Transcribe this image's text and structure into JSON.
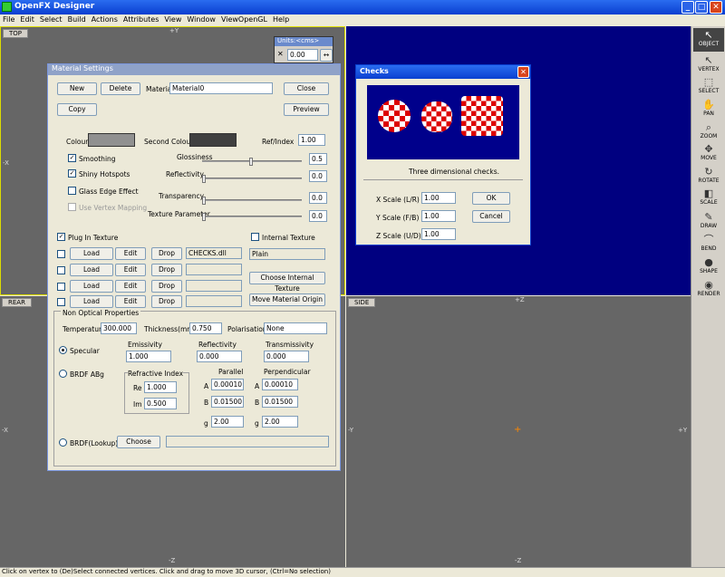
{
  "app": {
    "title": "OpenFX Designer",
    "min": "_",
    "max": "□",
    "close": "✕"
  },
  "menu": [
    "File",
    "Edit",
    "Select",
    "Build",
    "Actions",
    "Attributes",
    "View",
    "Window",
    "ViewOpenGL",
    "Help"
  ],
  "viewports": {
    "top": {
      "label": "TOP",
      "plus": "+Y",
      "minus": "-Y",
      "left": "-X",
      "right": "+X"
    },
    "rear": {
      "label": "REAR",
      "plus": "+Z",
      "minus": "-Z",
      "left": "-X",
      "right": "+X"
    },
    "side": {
      "label": "SIDE",
      "plus": "+Z",
      "minus": "-Z",
      "left": "-Y",
      "right": "+Y"
    }
  },
  "units": {
    "title": "Units:<cms>",
    "value": "0.00",
    "x": "✕",
    "icon": "↔"
  },
  "toolbar": [
    "OBJECT",
    "VERTEX",
    "SELECT",
    "PAN",
    "ZOOM",
    "MOVE",
    "ROTATE",
    "SCALE",
    "DRAW",
    "BEND",
    "SHAPE",
    "RENDER"
  ],
  "material": {
    "title": "Material Settings",
    "new": "New",
    "delete": "Delete",
    "material_label": "Material",
    "material_value": "Material0",
    "close": "Close",
    "copy": "Copy",
    "preview": "Preview",
    "colour": "Colour",
    "second_colour": "Second Colour",
    "refindex_label": "Ref/Index",
    "refindex": "1.00",
    "smoothing": "Smoothing",
    "shiny": "Shiny Hotspots",
    "glass": "Glass Edge Effect",
    "vertex_mapping": "Use Vertex Mapping",
    "glossiness": "Glossiness",
    "glossiness_val": "0.5",
    "reflectivity": "Reflectivity",
    "reflectivity_val": "0.0",
    "transparency": "Transparency",
    "transparency_val": "0.0",
    "texture_param": "Texture Parameter",
    "texture_param_val": "0.0",
    "plugin_texture": "Plug In Texture",
    "internal_texture": "Internal Texture",
    "internal_value": "Plain",
    "load": "Load",
    "edit": "Edit",
    "drop": "Drop",
    "dll": "CHECKS.dll",
    "choose_internal": "Choose Internal Texture",
    "move_origin": "Move Material Origin",
    "non_optical": "Non Optical Properties",
    "temperature": "Temperature",
    "temperature_val": "300.000",
    "thickness": "Thickness(mm)",
    "thickness_val": "0.750",
    "polarisation": "Polarisation",
    "polarisation_val": "None",
    "specular": "Specular",
    "emissivity": "Emissivity",
    "emissivity_val": "1.000",
    "reflectivity2": "Reflectivity",
    "reflectivity2_val": "0.000",
    "transmissivity": "Transmissivity",
    "transmissivity_val": "0.000",
    "brdf": "BRDF ABg",
    "refractive": "Refractive Index",
    "re": "Re",
    "re_val": "1.000",
    "im": "Im",
    "im_val": "0.500",
    "parallel": "Parallel",
    "perpendicular": "Perpendicular",
    "a": "A",
    "b": "B",
    "g": "g",
    "pa": "0.00010",
    "pb": "0.01500",
    "pg": "2.00",
    "qa": "0.00010",
    "qb": "0.01500",
    "qg": "2.00",
    "brdf_lookup": "BRDF(Lookup)",
    "choose": "Choose"
  },
  "checks": {
    "title": "Checks",
    "desc": "Three dimensional checks.",
    "xs": "X Scale (L/R)",
    "ys": "Y Scale (F/B)",
    "zs": "Z Scale (U/D)",
    "xv": "1.00",
    "yv": "1.00",
    "zv": "1.00",
    "ok": "OK",
    "cancel": "Cancel"
  },
  "status": "Click on vertex to (De)Select connected vertices. Click and drag to move 3D cursor, (Ctrl=No selection)",
  "colors": {
    "viewport": "#666666",
    "blue_view": "#000080",
    "colour_swatch": "#909090",
    "second_swatch": "#404040"
  }
}
